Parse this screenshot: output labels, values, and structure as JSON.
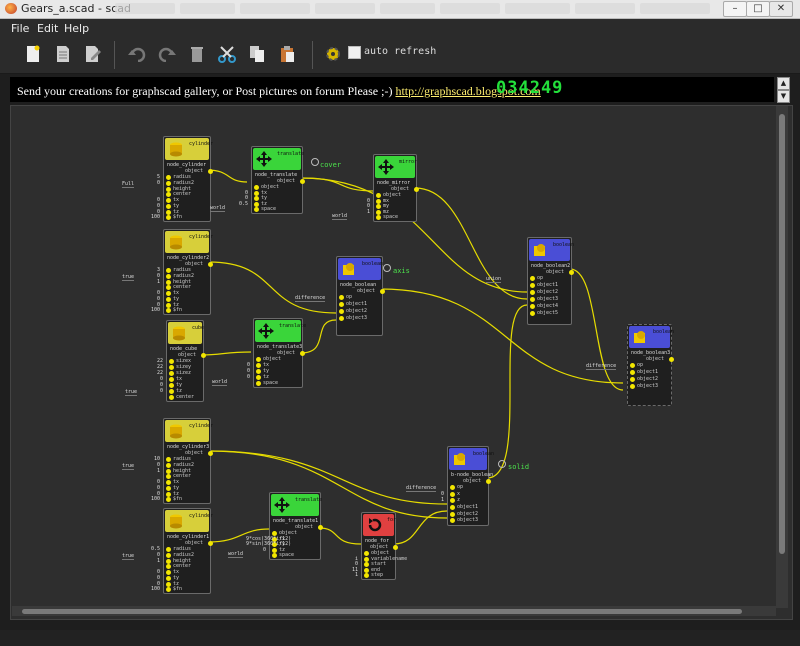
{
  "window": {
    "title": "Gears_a.scad - scad",
    "min": "–",
    "max": "□",
    "close": "✕"
  },
  "menu": [
    "File",
    "Edit",
    "Help"
  ],
  "toolbar": {
    "auto_refresh_label": "auto refresh",
    "auto_refresh_checked": false
  },
  "banner": {
    "text": "Send your creations for graphscad gallery, or Post pictures on forum Please ;-) ",
    "link": "http://graphscad.blogspot.com",
    "counter": "034249",
    "scroll_up": "▲",
    "scroll_down": "▼"
  },
  "colors": {
    "yellow_node": "#d7cf3a",
    "green_node": "#3ad53a",
    "blue_node": "#4a4ed6",
    "red_node": "#e04040",
    "wire": "#f2e600",
    "counter": "#23e03b"
  },
  "labels": {
    "cover": "cover",
    "axis": "axis",
    "solid": "solid"
  },
  "nodes": [
    {
      "header": "cylinder",
      "name": "node_cylinder",
      "ports": [
        "radius",
        "radius2",
        "height",
        "center",
        "tx",
        "ty",
        "tz",
        "$fn"
      ],
      "values": [
        "5",
        "0",
        "",
        "",
        "0",
        "0",
        "0",
        "100"
      ],
      "out": "object",
      "side": "Full"
    },
    {
      "header": "translate",
      "name": "node_translate",
      "ports": [
        "object",
        "tx",
        "ty",
        "tz",
        "space"
      ],
      "values": [
        "",
        "0",
        "0",
        "0.5",
        ""
      ],
      "out": "object",
      "side": "world"
    },
    {
      "header": "mirror",
      "name": "node_mirror",
      "ports": [
        "object",
        "mx",
        "my",
        "mz",
        "space"
      ],
      "values": [
        "",
        "0",
        "0",
        "1",
        ""
      ],
      "out": "object",
      "side": "world"
    },
    {
      "header": "cylinder",
      "name": "node_cylinder2",
      "ports": [
        "radius",
        "radius2",
        "height",
        "center",
        "tx",
        "ty",
        "tz",
        "$fn"
      ],
      "values": [
        "3",
        "0",
        "1",
        "",
        "0",
        "0",
        "0",
        "100"
      ],
      "out": "object",
      "side": "true"
    },
    {
      "header": "boolean",
      "name": "node_boolean",
      "ports": [
        "op",
        "object1",
        "object2",
        "object3"
      ],
      "values": [
        "",
        "",
        "",
        ""
      ],
      "out": "object",
      "side": "difference"
    },
    {
      "header": "boolean",
      "name": "node_boolean2",
      "ports": [
        "op",
        "object1",
        "object2",
        "object3",
        "object4",
        "object5"
      ],
      "values": [
        "",
        "",
        "",
        "",
        "",
        ""
      ],
      "out": "object",
      "side": "union"
    },
    {
      "header": "cube",
      "name": "node_cube",
      "ports": [
        "sizex",
        "sizey",
        "sizez",
        "tx",
        "ty",
        "tz",
        "center"
      ],
      "values": [
        "22",
        "22",
        "22",
        "0",
        "0",
        "0",
        ""
      ],
      "out": "object",
      "side": "true"
    },
    {
      "header": "translate",
      "name": "node_translate3",
      "ports": [
        "object",
        "tx",
        "ty",
        "tz",
        "space"
      ],
      "values": [
        "",
        "0",
        "0",
        "0",
        ""
      ],
      "out": "object",
      "side": "world"
    },
    {
      "header": "boolean",
      "name": "node_boolean3",
      "ports": [
        "op",
        "object1",
        "object2",
        "object3"
      ],
      "values": [
        "",
        "",
        "",
        ""
      ],
      "out": "object",
      "side": "difference"
    },
    {
      "header": "cylinder",
      "name": "node_cylinder3",
      "ports": [
        "radius",
        "radius2",
        "height",
        "center",
        "tx",
        "ty",
        "tz",
        "$fn"
      ],
      "values": [
        "10",
        "0",
        "1",
        "",
        "0",
        "0",
        "0",
        "100"
      ],
      "out": "object",
      "side": "true"
    },
    {
      "header": "boolean",
      "name": "b-node_boolean",
      "ports": [
        "op",
        "x",
        "z",
        "object1",
        "object2",
        "object3"
      ],
      "values": [
        "",
        "0",
        "1",
        "",
        "",
        ""
      ],
      "out": "object",
      "side": "difference"
    },
    {
      "header": "cylinder",
      "name": "node_cylinder1",
      "ports": [
        "radius",
        "radius2",
        "height",
        "center",
        "tx",
        "ty",
        "tz",
        "$fn"
      ],
      "values": [
        "0.5",
        "0",
        "1",
        "",
        "0",
        "0",
        "0",
        "100"
      ],
      "out": "object",
      "side": "true"
    },
    {
      "header": "translate",
      "name": "node_translate1",
      "ports": [
        "object",
        "tx",
        "ty",
        "tz",
        "space"
      ],
      "values": [
        "",
        "9*cos(360*i/12)",
        "9*sin(360*i/12)",
        "0",
        ""
      ],
      "out": "object",
      "side": "world"
    },
    {
      "header": "for",
      "name": "node_for",
      "ports": [
        "object",
        "variablename",
        "start",
        "end",
        "step"
      ],
      "values": [
        "",
        "i",
        "0",
        "11",
        "1"
      ],
      "out": "object",
      "side": ""
    }
  ]
}
